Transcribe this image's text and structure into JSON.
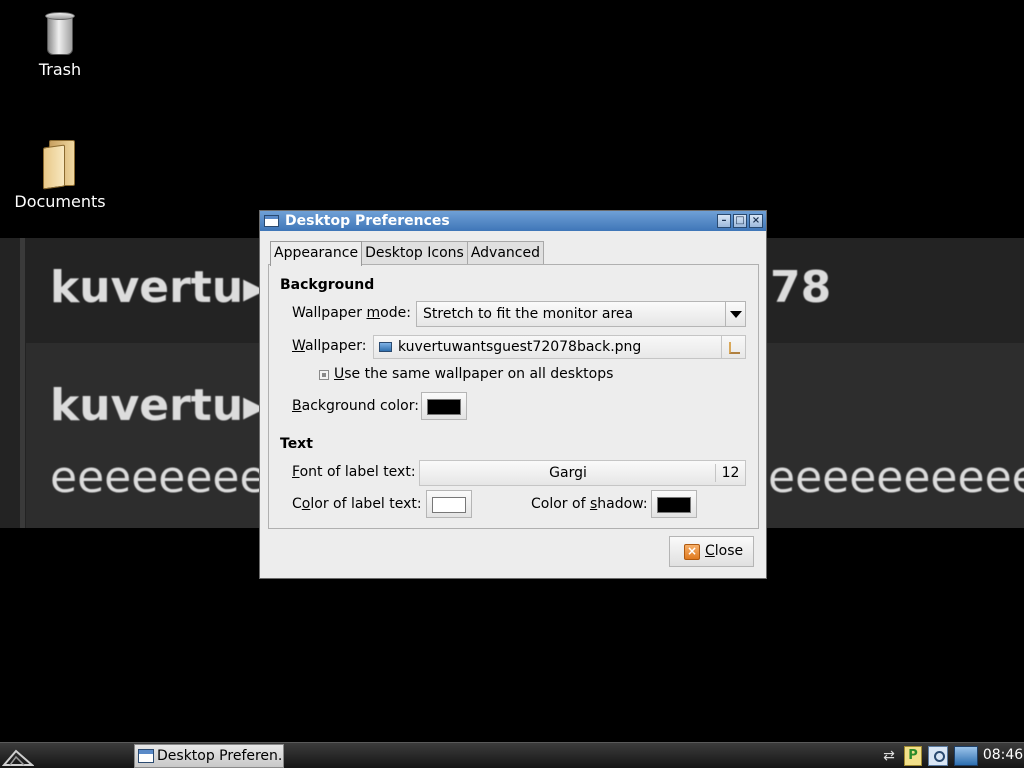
{
  "desktop": {
    "wallpaper_text": {
      "row1_left": "kuvertu▸",
      "row1_right": "78",
      "row2_left": "kuvertu▸",
      "row3_left": "eeeeeeee",
      "row3_right": "eeeeeeeeeee"
    },
    "icons": [
      {
        "label": "Trash",
        "icon": "trash-icon"
      },
      {
        "label": "Documents",
        "icon": "folder-icon"
      }
    ]
  },
  "dialog": {
    "title": "Desktop Preferences",
    "window_buttons": [
      "minimize",
      "maximize",
      "close"
    ],
    "tabs": [
      {
        "label": "Appearance",
        "active": true
      },
      {
        "label": "Desktop Icons",
        "active": false
      },
      {
        "label": "Advanced",
        "active": false
      }
    ],
    "background": {
      "heading": "Background",
      "wallpaper_mode_label_pre": "Wallpaper ",
      "wallpaper_mode_label_u": "m",
      "wallpaper_mode_label_post": "ode:",
      "wallpaper_mode_value": "Stretch to fit the monitor area",
      "wallpaper_label_u": "W",
      "wallpaper_label_post": "allpaper:",
      "wallpaper_file": "kuvertuwantsguest72078back.png",
      "same_wallpaper_u": "U",
      "same_wallpaper_post": "se the same wallpaper on all desktops",
      "same_wallpaper_checked": true,
      "bg_color_label_u": "B",
      "bg_color_label_post": "ackground color:",
      "bg_color": "#000000"
    },
    "text": {
      "heading": "Text",
      "font_label_pre": "",
      "font_label_u": "F",
      "font_label_post": "ont of label text:",
      "font_name": "Gargi",
      "font_size": "12",
      "label_color_pre": "C",
      "label_color_u": "o",
      "label_color_post": "lor of label text:",
      "label_color": "#ffffff",
      "shadow_color_pre": "Color of ",
      "shadow_color_u": "s",
      "shadow_color_post": "hadow:",
      "shadow_color": "#000000"
    },
    "close_label_u": "C",
    "close_label_post": "lose"
  },
  "taskbar": {
    "task_item": "Desktop Preferen...",
    "clock": "08:46",
    "tray_p": "P"
  }
}
